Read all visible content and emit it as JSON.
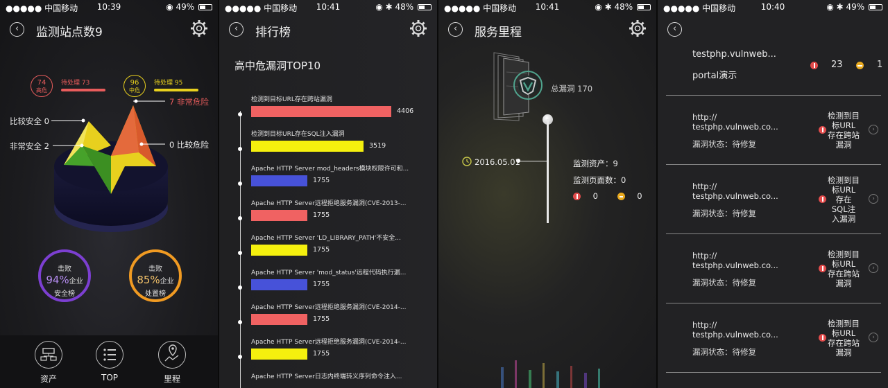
{
  "status_bars": [
    {
      "carrier": "●●●●● 中国移动",
      "time": "10:39",
      "battery": "49%",
      "battery_level": 0.49
    },
    {
      "carrier": "●●●●● 中国移动",
      "time": "10:41",
      "battery": "48%",
      "battery_level": 0.48
    },
    {
      "carrier": "●●●●● 中国移动",
      "time": "10:41",
      "battery": "48%",
      "battery_level": 0.48
    },
    {
      "carrier": "●●●●● 中国移动",
      "time": "10:40",
      "battery": "49%",
      "battery_level": 0.49
    }
  ],
  "screen1": {
    "title": "监测站点数9",
    "high": {
      "count": "74",
      "label": "高危",
      "pending": "待处理 73",
      "color": "#e85c5c"
    },
    "medium": {
      "count": "96",
      "label": "中危",
      "pending": "待处理 95",
      "color": "#e8d01e"
    },
    "labels": {
      "very_dangerous": "7 非常危险",
      "relatively_safe": "比较安全 0",
      "very_safe": "非常安全 2",
      "relatively_dangerous": "0 比较危险"
    },
    "ring_left": {
      "top": "击败",
      "percent": "94%",
      "suffix": "企业",
      "bottom": "安全榜",
      "color": "#7c3fd1"
    },
    "ring_right": {
      "top": "击败",
      "percent": "85%",
      "suffix": "企业",
      "bottom": "处置榜",
      "color": "#f09a22"
    },
    "tabs": [
      {
        "label": "资产",
        "icon": "asset-network-icon"
      },
      {
        "label": "TOP",
        "icon": "list-icon"
      },
      {
        "label": "里程",
        "icon": "map-pin-icon"
      }
    ]
  },
  "screen2": {
    "title": "排行榜",
    "heading": "高中危漏洞TOP10",
    "items": [
      {
        "name": "检测到目标URL存在跨站漏洞",
        "value": "4406",
        "share": 1.0,
        "color": "#f06262"
      },
      {
        "name": "检测到目标URL存在SQL注入漏洞",
        "value": "3519",
        "share": 0.8,
        "color": "#f5f00e"
      },
      {
        "name": "Apache HTTP Server mod_headers模块权限许可和...",
        "value": "1755",
        "share": 0.4,
        "color": "#4752d9"
      },
      {
        "name": "Apache HTTP Server远程拒绝服务漏洞(CVE-2013-...",
        "value": "1755",
        "share": 0.4,
        "color": "#f06262"
      },
      {
        "name": "Apache HTTP Server 'LD_LIBRARY_PATH'不安全...",
        "value": "1755",
        "share": 0.4,
        "color": "#f5f00e"
      },
      {
        "name": "Apache HTTP Server 'mod_status'远程代码执行漏...",
        "value": "1755",
        "share": 0.4,
        "color": "#4752d9"
      },
      {
        "name": "Apache HTTP Server远程拒绝服务漏洞(CVE-2014-...",
        "value": "1755",
        "share": 0.4,
        "color": "#f06262"
      },
      {
        "name": "Apache HTTP Server远程拒绝服务漏洞(CVE-2014-...",
        "value": "1755",
        "share": 0.4,
        "color": "#f5f00e"
      },
      {
        "name": "Apache HTTP Server日志内终端转义序列命令注入...",
        "value": "",
        "share": 0,
        "color": "#4752d9"
      }
    ]
  },
  "screen3": {
    "title": "服务里程",
    "total": "总漏洞 170",
    "date": "2016.05.01",
    "assets": "监测资产：9",
    "pages": "监测页面数：0",
    "high_count": "0",
    "medium_count": "0"
  },
  "screen4": {
    "top": {
      "site": "testphp.vulnweb...",
      "name": "portal演示",
      "high": "23",
      "medium": "1"
    },
    "rows": [
      {
        "url1": "http://",
        "url2": "testphp.vulnweb.co...",
        "state": "漏洞状态：待修复",
        "vuln": [
          "检测到目",
          "标URL",
          "存在跨站",
          "漏洞"
        ]
      },
      {
        "url1": "http://",
        "url2": "testphp.vulnweb.co...",
        "state": "漏洞状态：待修复",
        "vuln": [
          "检测到目",
          "标URL",
          "存在",
          "SQL注",
          "入漏洞"
        ]
      },
      {
        "url1": "http://",
        "url2": "testphp.vulnweb.co...",
        "state": "漏洞状态：待修复",
        "vuln": [
          "检测到目",
          "标URL",
          "存在跨站",
          "漏洞"
        ]
      },
      {
        "url1": "http://",
        "url2": "testphp.vulnweb.co...",
        "state": "漏洞状态：待修复",
        "vuln": [
          "检测到目",
          "标URL",
          "存在跨站",
          "漏洞"
        ]
      }
    ]
  }
}
